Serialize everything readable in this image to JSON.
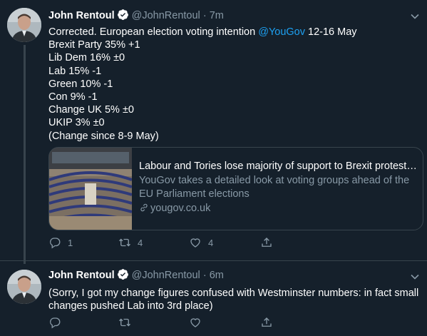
{
  "colors": {
    "background": "#15202b",
    "text": "#ffffff",
    "muted": "#8899a6",
    "accent": "#1da1f2",
    "border": "#38444d"
  },
  "tweets": [
    {
      "author_name": "John Rentoul",
      "handle": "@JohnRentoul",
      "separator": "·",
      "time": "7m",
      "verified": true,
      "text_prefix": "Corrected. European election voting intention ",
      "mention": "@YouGov",
      "text_suffix": " 12-16 May",
      "lines": [
        "Brexit Party 35% +1",
        "Lib Dem 16% ±0",
        "Lab 15% -1",
        "Green 10% -1",
        "Con 9% -1",
        "Change UK 5% ±0",
        "UKIP 3% ±0",
        "(Change since 8-9 May)"
      ],
      "card": {
        "title": "Labour and Tories lose majority of support to Brexit protest | ...",
        "description": "YouGov takes a detailed look at voting groups ahead of the EU Parliament elections",
        "domain": "yougov.co.uk"
      },
      "actions": {
        "replies": "1",
        "retweets": "4",
        "likes": "4"
      }
    },
    {
      "author_name": "John Rentoul",
      "handle": "@JohnRentoul",
      "separator": "·",
      "time": "6m",
      "verified": true,
      "lines": [
        "(Sorry, I got my change figures confused with Westminster numbers: in fact small",
        "changes pushed Lab into 3rd place)"
      ],
      "actions": {
        "replies": "",
        "retweets": "",
        "likes": ""
      }
    }
  ],
  "icons": {
    "verified": "verified-badge-icon",
    "caret": "chevron-down-icon",
    "reply": "reply-icon",
    "retweet": "retweet-icon",
    "like": "heart-icon",
    "share": "share-icon",
    "link": "link-icon"
  }
}
